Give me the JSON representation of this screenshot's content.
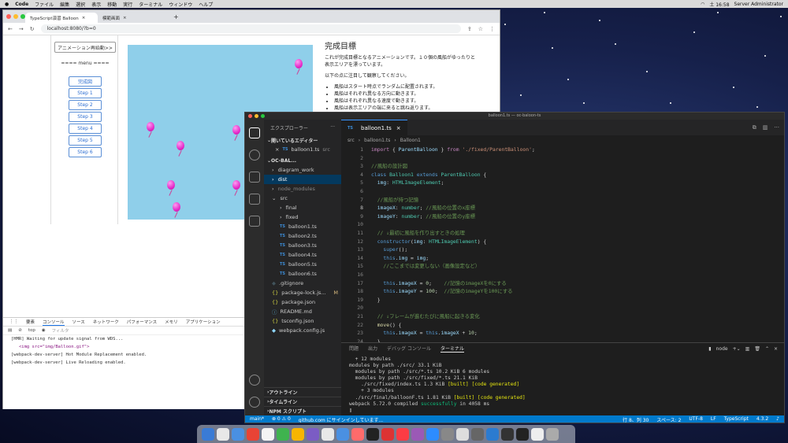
{
  "menubar": {
    "app": "Code",
    "items": [
      "ファイル",
      "編集",
      "選択",
      "表示",
      "移動",
      "実行",
      "ターミナル",
      "ウィンドウ",
      "ヘルプ"
    ],
    "clock": "土 16:58",
    "user": "Server Administrator"
  },
  "browser": {
    "tabs": [
      "TypeScript演習 Balloon",
      "模範画面"
    ],
    "url": "localhost:8080/?b=0",
    "anim_button": "アニメーション再始動>>",
    "menu_label": "==== menu ====",
    "steps": [
      "完成図",
      "Step 1",
      "Step 2",
      "Step 3",
      "Step 4",
      "Step 5",
      "Step 6"
    ],
    "goal_title": "完成目標",
    "goal_desc": "これが完成目標となるアニメーションです。１０個の風船がゆったりと表示エリアを漂っています。",
    "goal_note": "以下の点に注目して観察してください。",
    "goal_points": [
      "風船はスタート時点でランダムに配置されます。",
      "風船はそれぞれ異なる方向に動きます。",
      "風船はそれぞれ異なる速度で動きます。",
      "風船は表示エリアの端に来ると跳ね返ります。"
    ]
  },
  "devtools": {
    "tabs": [
      "要素",
      "コンソール",
      "ソース",
      "ネットワーク",
      "パフォーマンス",
      "メモリ",
      "アプリケーション"
    ],
    "context": "top",
    "filter_placeholder": "フィルタ",
    "lines": [
      "[HMR] Waiting for update signal from WDS...",
      "<img src=\"img/Balloon.gif\">",
      "[webpack-dev-server] Hot Module Replacement enabled.",
      "[webpack-dev-server] Live Reloading enabled."
    ]
  },
  "vscode": {
    "title": "balloon1.ts — oc-baloon-ts",
    "explorer_label": "エクスプローラー",
    "open_editors": "開いているエディター",
    "open_file": "balloon1.ts",
    "open_file_dir": "src",
    "project": "OC-BAL...",
    "tree": [
      {
        "name": "diagram_work",
        "kind": "folder",
        "indent": 1
      },
      {
        "name": "dist",
        "kind": "folder",
        "indent": 1,
        "sel": true
      },
      {
        "name": "node_modules",
        "kind": "folder",
        "indent": 1,
        "dim": true
      },
      {
        "name": "src",
        "kind": "folder-open",
        "indent": 1
      },
      {
        "name": "final",
        "kind": "folder",
        "indent": 2
      },
      {
        "name": "fixed",
        "kind": "folder",
        "indent": 2
      },
      {
        "name": "balloon1.ts",
        "kind": "ts",
        "indent": 2
      },
      {
        "name": "balloon2.ts",
        "kind": "ts",
        "indent": 2
      },
      {
        "name": "balloon3.ts",
        "kind": "ts",
        "indent": 2
      },
      {
        "name": "balloon4.ts",
        "kind": "ts",
        "indent": 2
      },
      {
        "name": "balloon5.ts",
        "kind": "ts",
        "indent": 2
      },
      {
        "name": "balloon6.ts",
        "kind": "ts",
        "indent": 2
      },
      {
        "name": ".gitignore",
        "kind": "file",
        "indent": 1
      },
      {
        "name": "package-lock.js...",
        "kind": "json",
        "indent": 1,
        "mod": "M"
      },
      {
        "name": "package.json",
        "kind": "json",
        "indent": 1
      },
      {
        "name": "README.md",
        "kind": "md",
        "indent": 1
      },
      {
        "name": "tsconfig.json",
        "kind": "json",
        "indent": 1
      },
      {
        "name": "webpack.config.js",
        "kind": "js",
        "indent": 1
      }
    ],
    "bottom_sections": [
      "アウトライン",
      "タイムライン",
      "NPM スクリプト"
    ],
    "editor_tab": "balloon1.ts",
    "breadcrumb": [
      "src",
      "balloon1.ts",
      "Balloon1"
    ],
    "code": [
      "<span class='kk'>import</span> { <span class='v'>ParentBalloon</span> } <span class='kk'>from</span> <span class='s'>'./fixed/ParentBalloon'</span>;",
      "",
      "<span class='c'>//風船の設計図</span>",
      "<span class='k'>class</span> <span class='t'>Balloon1</span> <span class='k'>extends</span> <span class='t'>ParentBalloon</span> {",
      "  <span class='v'>img</span>: <span class='t'>HTMLImageElement</span>;",
      "",
      "  <span class='c'>//風船が持つ記憶</span>",
      "  <span class='v'>imageX</span>: <span class='t'>number</span>; <span class='c'>//風船の位置のx座標</span>",
      "  <span class='v'>imageY</span>: <span class='t'>number</span>; <span class='c'>//風船の位置のy座標</span>",
      "",
      "  <span class='c'>// ↓最初に風船を作り出すときの処理</span>",
      "  <span class='k'>constructor</span>(<span class='v'>img</span>: <span class='t'>HTMLImageElement</span>) {",
      "    <span class='k'>super</span>();",
      "    <span class='k'>this</span>.<span class='v'>img</span> = <span class='v'>img</span>;",
      "    <span class='c'>//ここまでは変更しない（画像設定など）</span>",
      "",
      "    <span class='k'>this</span>.<span class='v'>imageX</span> = <span class='n'>0</span>;    <span class='c'>//記憶のimageXを0にする</span>",
      "    <span class='k'>this</span>.<span class='v'>imageY</span> = <span class='n'>100</span>;  <span class='c'>//記憶のimageYを100にする</span>",
      "  }",
      "",
      "  <span class='c'>// ↓フレームが進むたびに風船に起きる変化</span>",
      "  <span class='f'>move</span>() {",
      "    <span class='k'>this</span>.<span class='v'>imageX</span> = <span class='k'>this</span>.<span class='v'>imageX</span> + <span class='n'>10</span>;",
      "  }"
    ],
    "current_line": 8,
    "panel_tabs": [
      "問題",
      "出力",
      "デバッグ コンソール",
      "ターミナル"
    ],
    "panel_active": 3,
    "shell": "node",
    "terminal": [
      "  + 12 modules",
      "modules by path ./src/ 33.1 KiB",
      "  modules by path ./src/*.ts 10.2 KiB 6 modules",
      "  modules by path ./src/fixed/*.ts 21.1 KiB",
      "    ./src/fixed/index.ts 1.3 KiB <span class='y'>[built]</span> <span class='y'>[code generated]</span>",
      "    + 3 modules",
      "  ./src/final/balloonF.ts 1.81 KiB <span class='y'>[built]</span> <span class='y'>[code generated]</span>",
      "webpack 5.72.0 compiled <span class='g'>successfully</span> in 4058 ms",
      "<span class='w'>▯</span>"
    ],
    "status_left": [
      "main*",
      "⊗ 0 ⚠ 0",
      "github.com にサインインしています..."
    ],
    "status_right": [
      "行 8、列 30",
      "スペース: 2",
      "UTF-8",
      "LF",
      "TypeScript",
      "4.3.2"
    ]
  }
}
